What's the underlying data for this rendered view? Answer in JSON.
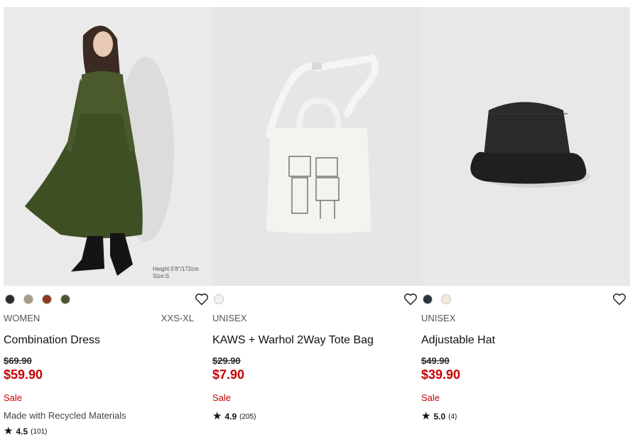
{
  "products": [
    {
      "image_caption_line1": "Height:5'8\"/172cm",
      "image_caption_line2": "Size:S",
      "swatches": [
        "#2b2b2b",
        "#a89c86",
        "#8a3a22",
        "#4b5530"
      ],
      "gender": "WOMEN",
      "size_range": "XXS-XL",
      "name": "Combination Dress",
      "original_price": "$69.90",
      "sale_price": "$59.90",
      "sale_label": "Sale",
      "extra_label": "Made with Recycled Materials",
      "rating": "4.5",
      "review_count": "(101)"
    },
    {
      "swatches": [
        "#f4f1ee"
      ],
      "gender": "UNISEX",
      "name": "KAWS + Warhol 2Way Tote Bag",
      "original_price": "$29.90",
      "sale_price": "$7.90",
      "sale_label": "Sale",
      "rating": "4.9",
      "review_count": "(205)"
    },
    {
      "swatches": [
        "#2f3540",
        "#f1ead8"
      ],
      "gender": "UNISEX",
      "name": "Adjustable Hat",
      "original_price": "$49.90",
      "sale_price": "$39.90",
      "sale_label": "Sale",
      "rating": "5.0",
      "review_count": "(4)"
    }
  ],
  "icons": {
    "favorite": "heart-outline-icon",
    "rating": "star-icon"
  },
  "colors": {
    "sale_red": "#c80000",
    "text": "#1b1b1b"
  }
}
